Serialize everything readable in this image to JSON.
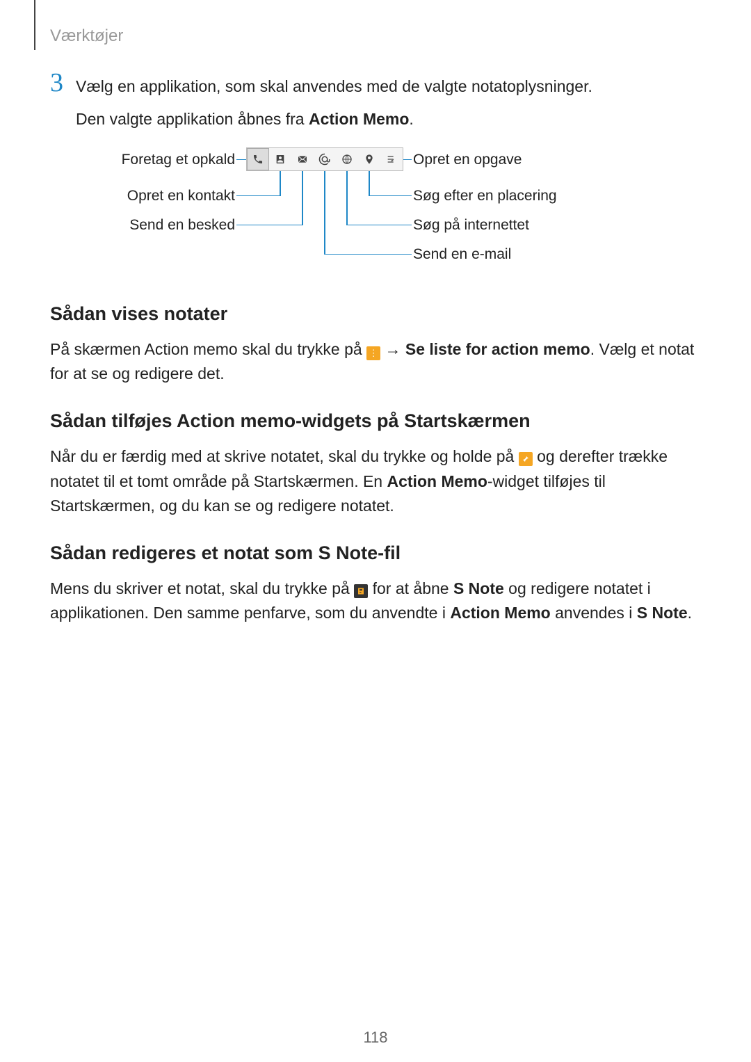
{
  "breadcrumb": "Værktøjer",
  "step": {
    "num": "3",
    "line1": "Vælg en applikation, som skal anvendes med de valgte notatoplysninger.",
    "line2_a": "Den valgte applikation åbnes fra ",
    "line2_b": "Action Memo",
    "line2_c": "."
  },
  "diagram": {
    "left": {
      "l1": "Foretag et opkald",
      "l2": "Opret en kontakt",
      "l3": "Send en besked"
    },
    "right": {
      "r1": "Opret en opgave",
      "r2": "Søg efter en placering",
      "r3": "Søg på internettet",
      "r4": "Send en e-mail"
    }
  },
  "section1": {
    "heading": "Sådan vises notater",
    "p1a": "På skærmen Action memo skal du trykke på ",
    "p1b": " → ",
    "p1c": "Se liste for action memo",
    "p1d": ". Vælg et notat for at se og redigere det."
  },
  "section2": {
    "heading": "Sådan tilføjes Action memo-widgets på Startskærmen",
    "p1a": "Når du er færdig med at skrive notatet, skal du trykke og holde på ",
    "p1b": " og derefter trække notatet til et tomt område på Startskærmen. En ",
    "p1c": "Action Memo",
    "p1d": "-widget tilføjes til Startskærmen, og du kan se og redigere notatet."
  },
  "section3": {
    "heading": "Sådan redigeres et notat som S Note-fil",
    "p1a": "Mens du skriver et notat, skal du trykke på ",
    "p1b": " for at åbne ",
    "p1c": "S Note",
    "p1d": " og redigere notatet i applikationen. Den samme penfarve, som du anvendte i ",
    "p1e": "Action Memo",
    "p1f": " anvendes i ",
    "p1g": "S Note",
    "p1h": "."
  },
  "pagenum": "118"
}
